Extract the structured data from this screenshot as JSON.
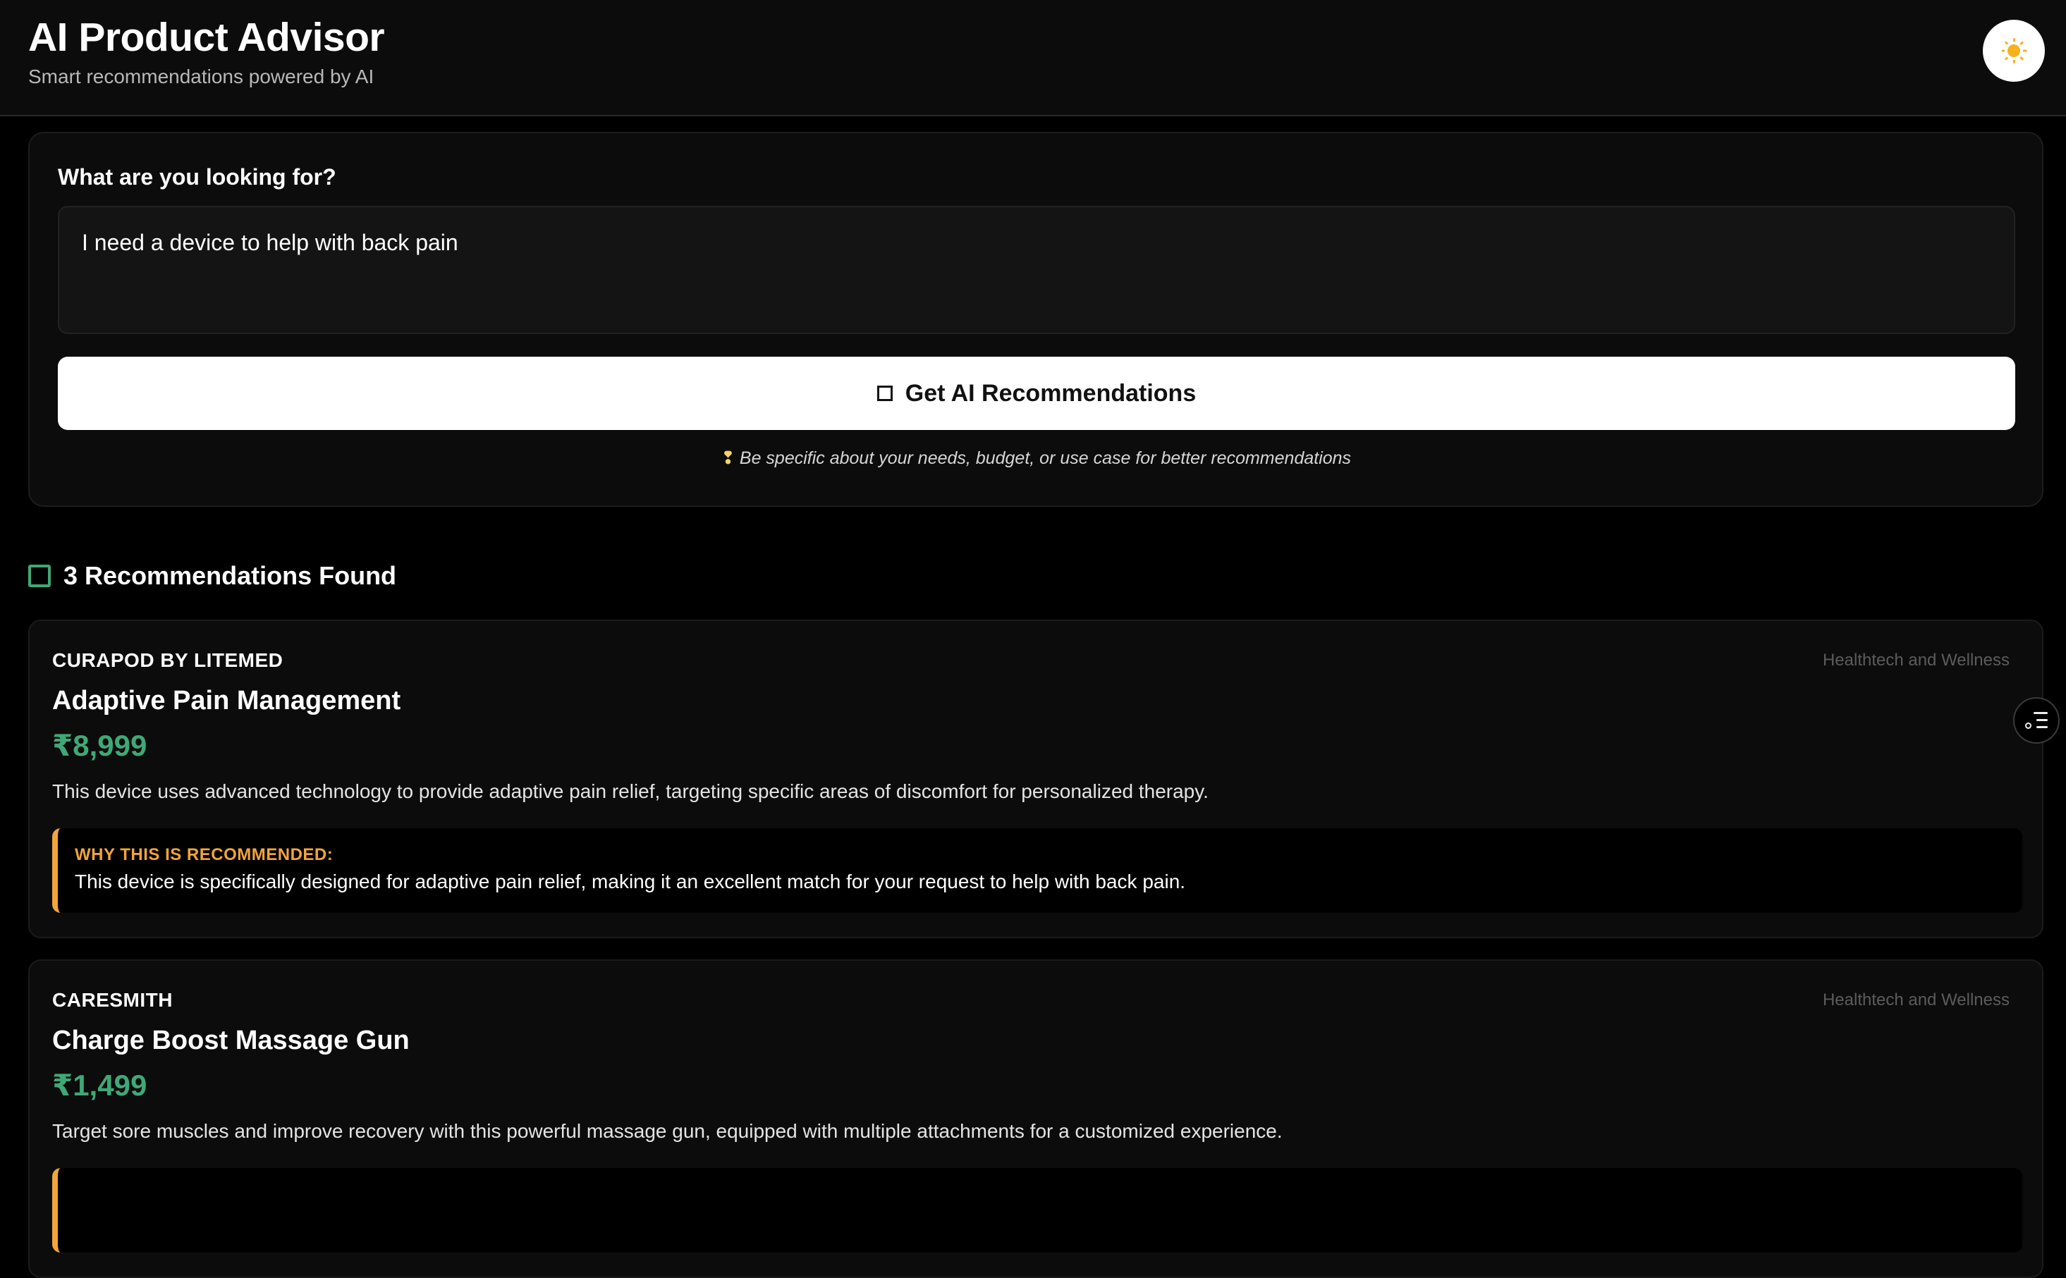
{
  "header": {
    "title": "AI Product Advisor",
    "subtitle": "Smart recommendations powered by AI",
    "theme_toggle_icon": "sun-icon"
  },
  "search": {
    "label": "What are you looking for?",
    "query_value": "I need a device to help with back pain",
    "button_icon": "sparkle-icon",
    "button_label": "Get AI Recommendations",
    "tip_icon": "lightbulb-icon",
    "tip": "Be specific about your needs, budget, or use case for better recommendations"
  },
  "results": {
    "icon": "check-square-icon",
    "heading": "3 Recommendations Found",
    "products": [
      {
        "brand": "CURAPOD BY LITEMED",
        "category": "Healthtech and Wellness",
        "name": "Adaptive Pain Management",
        "price": "₹8,999",
        "description": "This device uses advanced technology to provide adaptive pain relief, targeting specific areas of discomfort for personalized therapy.",
        "why_label": "WHY THIS IS RECOMMENDED:",
        "why_text": "This device is specifically designed for adaptive pain relief, making it an excellent match for your request to help with back pain."
      },
      {
        "brand": "CARESMITH",
        "category": "Healthtech and Wellness",
        "name": "Charge Boost Massage Gun",
        "price": "₹1,499",
        "description": "Target sore muscles and improve recovery with this powerful massage gun, equipped with multiple attachments for a customized experience."
      }
    ]
  },
  "floating_button_icon": "filter-settings-icon",
  "colors": {
    "background": "#000000",
    "price_green": "#3fa877",
    "accent_orange": "#f1a53a",
    "button_bg": "#ffffff"
  }
}
